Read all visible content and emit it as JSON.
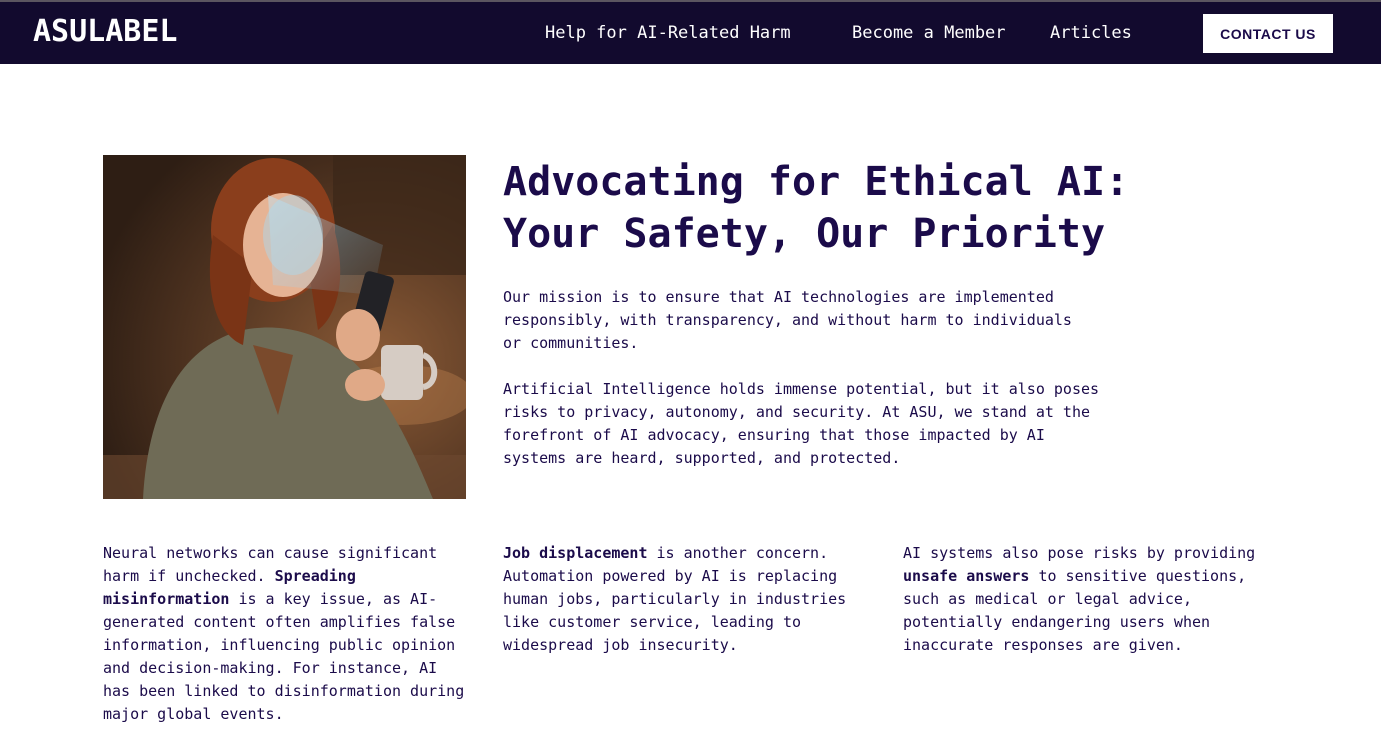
{
  "header": {
    "logo": "ASULABEL",
    "nav": [
      {
        "label": "Help for AI-Related Harm"
      },
      {
        "label": "Become a Member"
      },
      {
        "label": "Articles"
      }
    ],
    "contact_label": "CONTACT US",
    "background_color": "#120a2e"
  },
  "hero": {
    "image_icon": "woman-with-phone-photo",
    "headline_line1": "Advocating for Ethical AI:",
    "headline_line2": "Your Safety, Our Priority",
    "mission": "Our mission is to ensure that AI technologies are implemented\nresponsibly, with transparency, and without harm to individuals\nor communities.",
    "potential": "Artificial Intelligence holds immense potential, but it also poses\nrisks to privacy, autonomy, and security. At ASU, we stand at the\nforefront of AI advocacy, ensuring that those impacted by AI\nsystems are heard, supported, and protected."
  },
  "columns": [
    {
      "pre": "Neural networks can cause significant\nharm if unchecked. ",
      "bold": "Spreading\nmisinformation",
      "post": " is a key issue, as AI-\ngenerated content often amplifies false\ninformation, influencing public opinion\nand decision-making. For instance, AI\nhas been linked to disinformation during\nmajor global events."
    },
    {
      "pre": "",
      "bold": "Job displacement",
      "post": " is another concern.\nAutomation powered by AI is replacing\nhuman jobs, particularly in industries\nlike customer service, leading to\nwidespread job insecurity."
    },
    {
      "pre": "AI systems also pose risks by providing\n",
      "bold": "unsafe answers",
      "post": " to sensitive questions,\nsuch as medical or legal advice,\npotentially endangering users when\ninaccurate responses are given."
    }
  ],
  "colors": {
    "text": "#1b0b4a",
    "navbar": "#120a2e"
  }
}
